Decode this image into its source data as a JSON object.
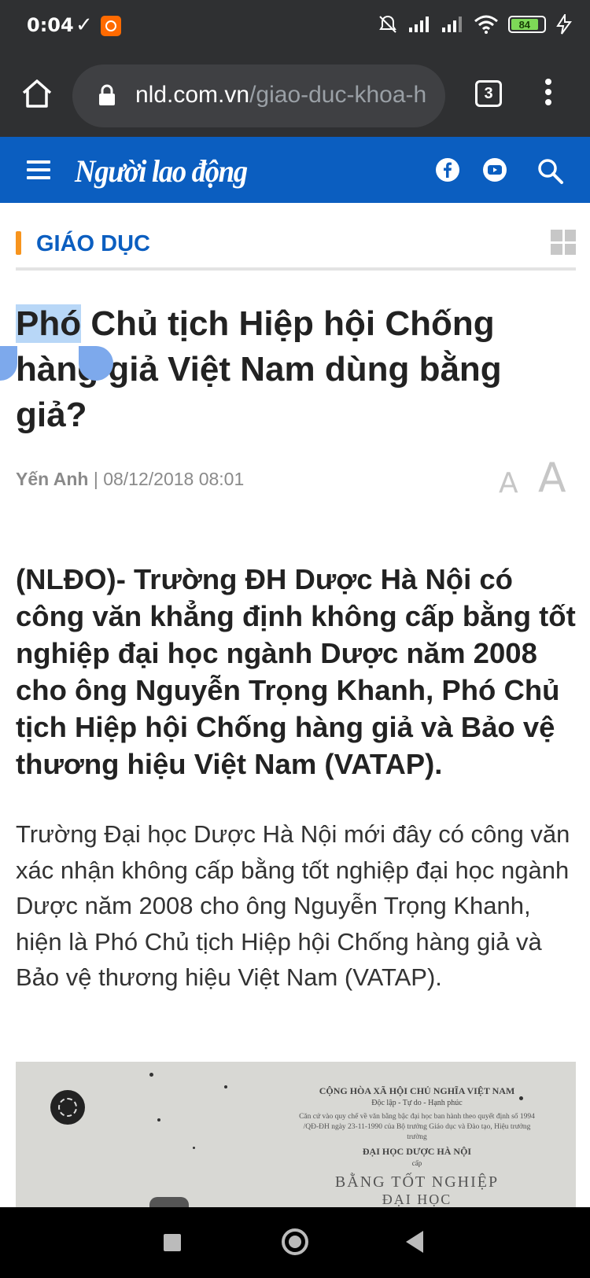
{
  "status_bar": {
    "time": "0:04",
    "battery": "84"
  },
  "browser": {
    "url_domain": "nld.com.vn",
    "url_path": "/giao-duc-khoa-h",
    "tab_count": "3"
  },
  "site": {
    "logo": "Người lao động"
  },
  "section": {
    "label": "GIÁO DỤC"
  },
  "article": {
    "title_selected": "Phó",
    "title_rest": " Chủ tịch Hiệp hội Chống hàng giả Việt Nam dùng bằng giả?",
    "author": "Yến Anh",
    "separator": " | ",
    "datetime": "08/12/2018 08:01",
    "font_small": "A",
    "font_large": "A",
    "lead": "(NLĐO)- Trường ĐH Dược Hà Nội có công văn khẳng định không cấp bằng tốt nghiệp đại học ngành Dược năm 2008 cho ông Nguyễn Trọng Khanh, Phó Chủ tịch Hiệp hội Chống hàng giả và Bảo vệ thương hiệu Việt Nam (VATAP).",
    "body": "Trường Đại học Dược Hà Nội mới đây có công văn xác nhận không cấp bằng tốt nghiệp đại học ngành Dược năm 2008 cho ông Nguyễn Trọng Khanh, hiện là Phó Chủ tịch Hiệp hội Chống hàng giả và Bảo vệ thương hiệu Việt Nam (VATAP)."
  },
  "photo_doc": {
    "line1": "CỘNG HÒA XÃ HỘI CHỦ NGHĨA VIỆT NAM",
    "line2": "Độc lập - Tự do - Hạnh phúc",
    "line3": "Căn cứ vào quy chế về văn bằng bậc đại học ban hành theo quyết định số 1994 /QĐ-ĐH ngày 23-11-1990 của Bộ trưởng Giáo dục và Đào tạo, Hiệu trưởng trường",
    "line4": "ĐẠI HỌC DƯỢC HÀ NỘI",
    "line5": "cấp",
    "line6": "BẰNG TỐT NGHIỆP",
    "line7": "ĐẠI HỌC"
  },
  "colors": {
    "brand_blue": "#0b5ec0",
    "section_accent": "#f7941d",
    "selection": "#b8d7f7"
  }
}
